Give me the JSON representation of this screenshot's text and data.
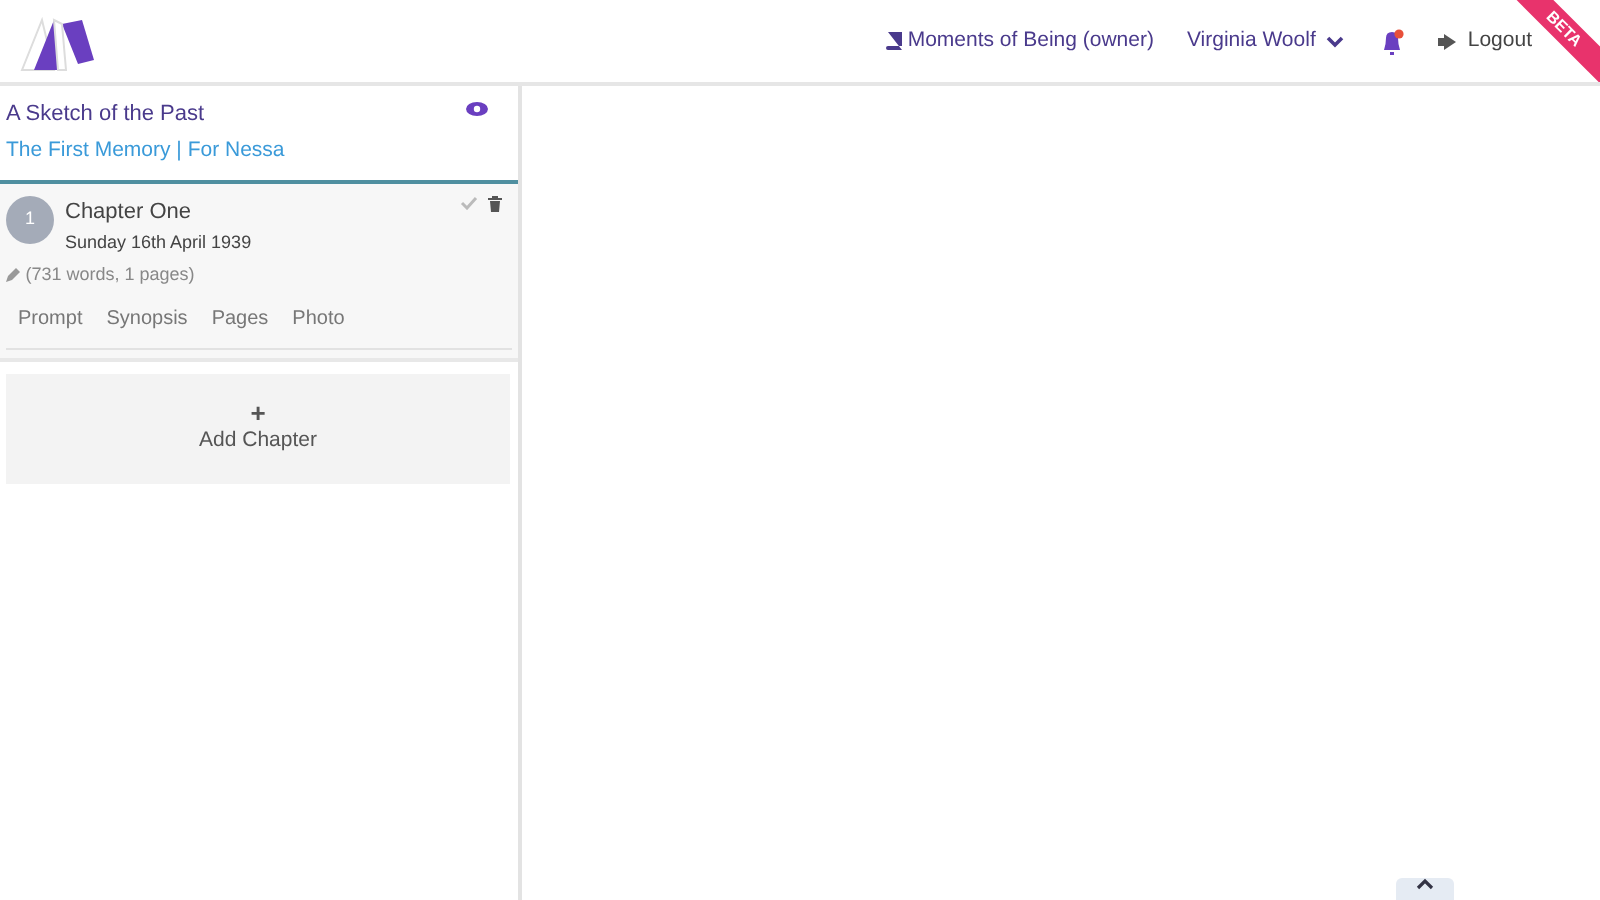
{
  "navbar": {
    "book": "Moments of Being (owner)",
    "user": "Virginia Woolf",
    "logout": "Logout",
    "badge": "BETA",
    "notification": true
  },
  "story": {
    "title": "A Sketch of the Past",
    "subtitle": "The First Memory | For Nessa"
  },
  "chapters": [
    {
      "number": "1",
      "title": "Chapter One",
      "date": "Sunday 16th April 1939",
      "stats": "(731 words, 1 pages)",
      "done": false,
      "tabs": [
        {
          "label": "Prompt",
          "selected": false
        },
        {
          "label": "Synopsis",
          "selected": false
        },
        {
          "label": "Pages",
          "selected": false
        },
        {
          "label": "Photo",
          "selected": false
        }
      ]
    }
  ],
  "add_button": {
    "icon": "+",
    "label": "Add Chapter"
  }
}
